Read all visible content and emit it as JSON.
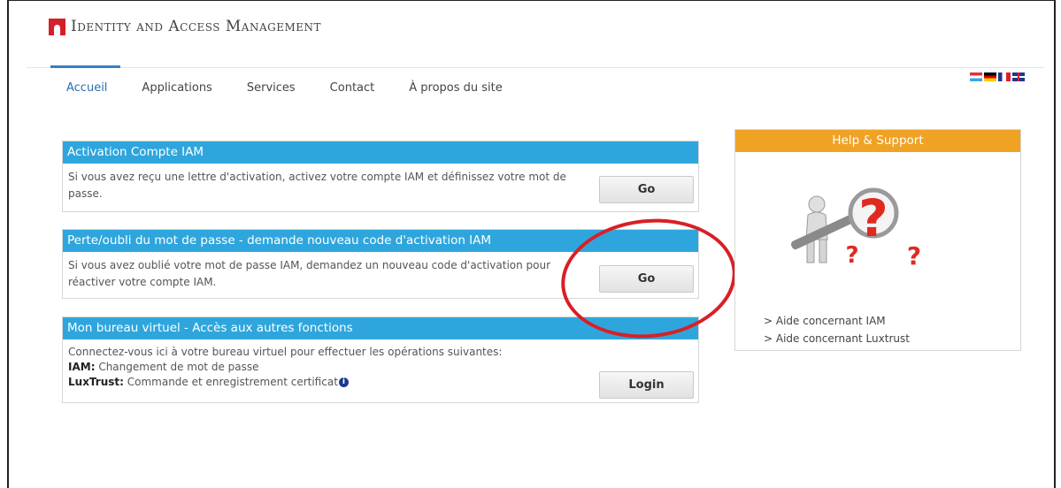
{
  "header": {
    "title": "Identity and Access Management"
  },
  "nav": {
    "items": [
      {
        "label": "Accueil"
      },
      {
        "label": "Applications"
      },
      {
        "label": "Services"
      },
      {
        "label": "Contact"
      },
      {
        "label": "À propos du site"
      }
    ],
    "active": "Accueil"
  },
  "languages": [
    "lu",
    "de",
    "fr",
    "en"
  ],
  "panels": {
    "activation": {
      "title": "Activation Compte IAM",
      "text": "Si vous avez reçu une lettre d'activation, activez votre compte IAM et définissez votre mot de passe.",
      "button": "Go"
    },
    "lost_password": {
      "title": "Perte/oubli du mot de passe - demande nouveau code d'activation IAM",
      "text": "Si vous avez oublié votre mot de passe IAM, demandez un nouveau code d'activation pour réactiver votre compte IAM.",
      "button": "Go"
    },
    "virtual_office": {
      "title": "Mon bureau virtuel - Accès aux autres fonctions",
      "intro": "Connectez-vous ici à votre bureau virtuel pour effectuer les opérations suivantes:",
      "line1_label": "IAM:",
      "line1_text": " Changement de mot de passe",
      "line2_label": "LuxTrust:",
      "line2_text": " Commande et enregistrement certificat",
      "info_icon": "i",
      "button": "Login"
    }
  },
  "help": {
    "title": "Help & Support",
    "links": [
      "> Aide concernant IAM",
      "> Aide concernant Luxtrust"
    ]
  },
  "colors": {
    "panel_header": "#2ea6dd",
    "help_header": "#f0a224",
    "annotation_circle": "#d91f26",
    "logo": "#d4202a"
  }
}
